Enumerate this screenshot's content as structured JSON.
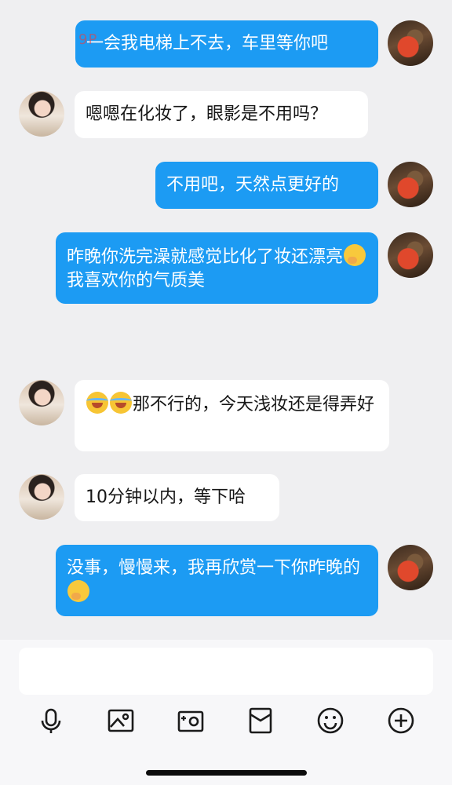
{
  "messages": [
    {
      "sender": "me",
      "text": "一会我电梯上不去，车里等你吧"
    },
    {
      "sender": "her",
      "text": "嗯嗯在化妆了，眼影是不用吗？"
    },
    {
      "sender": "me",
      "text": "不用吧，天然点更好的"
    },
    {
      "sender": "me",
      "text_a": "昨晚你洗完澡就感觉比化了妆还漂亮",
      "emoji": "giggle-emoji",
      "text_b": "我喜欢你的气质美"
    },
    {
      "sender": "her",
      "emoji": "laugh-cry-emoji",
      "text": "那不行的，今天浅妆还是得弄好"
    },
    {
      "sender": "her",
      "text": "10分钟以内，等下哈"
    },
    {
      "sender": "me",
      "text": "没事，慢慢来，我再欣赏一下你昨晚的",
      "emoji": "giggle-emoji"
    }
  ],
  "watermark": "9P",
  "composer": {
    "input_value": "",
    "tools": [
      "microphone-icon",
      "image-icon",
      "camera-icon",
      "red-packet-icon",
      "emoji-icon",
      "plus-icon"
    ]
  },
  "colors": {
    "me_bubble": "#1c9bf3",
    "her_bubble": "#ffffff",
    "background": "#efeff1"
  }
}
